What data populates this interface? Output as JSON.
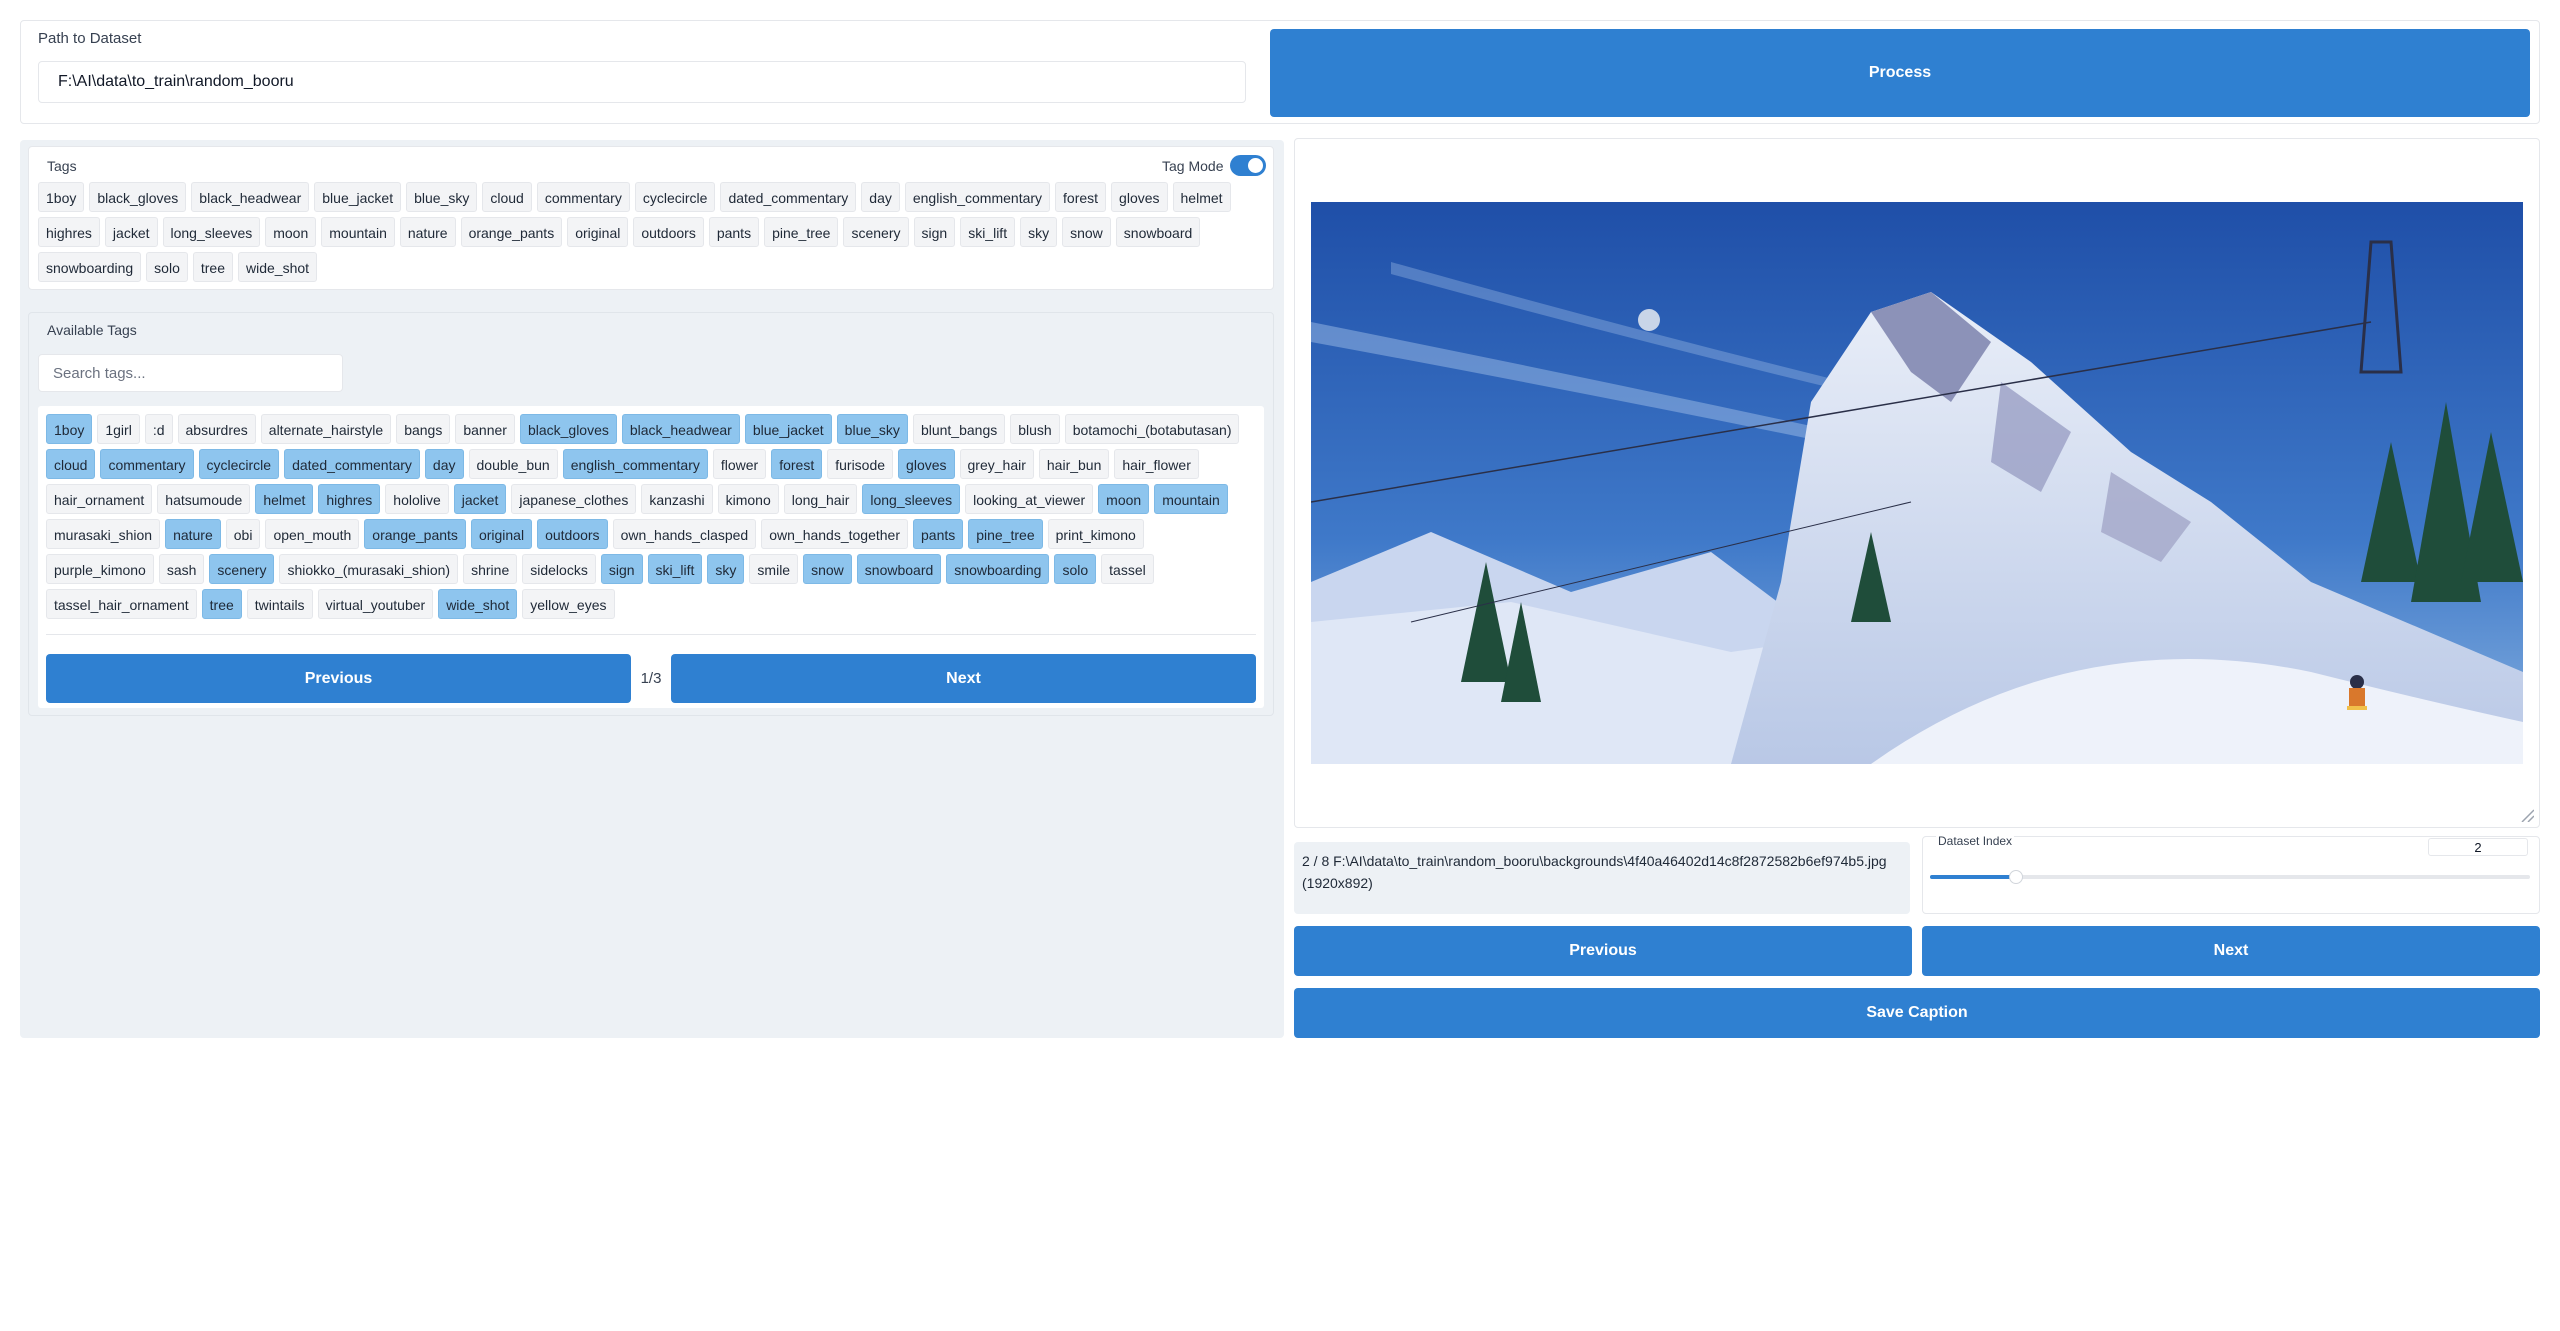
{
  "dataset": {
    "path_label": "Path to Dataset",
    "path_value": "F:\\AI\\data\\to_train\\random_booru",
    "process_label": "Process"
  },
  "tags_panel": {
    "label": "Tags",
    "tag_mode_label": "Tag Mode",
    "tag_mode_on": true,
    "tags": [
      "1boy",
      "black_gloves",
      "black_headwear",
      "blue_jacket",
      "blue_sky",
      "cloud",
      "commentary",
      "cyclecircle",
      "dated_commentary",
      "day",
      "english_commentary",
      "forest",
      "gloves",
      "helmet",
      "highres",
      "jacket",
      "long_sleeves",
      "moon",
      "mountain",
      "nature",
      "orange_pants",
      "original",
      "outdoors",
      "pants",
      "pine_tree",
      "scenery",
      "sign",
      "ski_lift",
      "sky",
      "snow",
      "snowboard",
      "snowboarding",
      "solo",
      "tree",
      "wide_shot"
    ]
  },
  "available_tags": {
    "label": "Available Tags",
    "search_placeholder": "Search tags...",
    "tags": [
      {
        "text": "1boy",
        "active": true
      },
      {
        "text": "1girl",
        "active": false
      },
      {
        "text": ":d",
        "active": false
      },
      {
        "text": "absurdres",
        "active": false
      },
      {
        "text": "alternate_hairstyle",
        "active": false
      },
      {
        "text": "bangs",
        "active": false
      },
      {
        "text": "banner",
        "active": false
      },
      {
        "text": "black_gloves",
        "active": true
      },
      {
        "text": "black_headwear",
        "active": true
      },
      {
        "text": "blue_jacket",
        "active": true
      },
      {
        "text": "blue_sky",
        "active": true
      },
      {
        "text": "blunt_bangs",
        "active": false
      },
      {
        "text": "blush",
        "active": false
      },
      {
        "text": "botamochi_(botabutasan)",
        "active": false
      },
      {
        "text": "cloud",
        "active": true
      },
      {
        "text": "commentary",
        "active": true
      },
      {
        "text": "cyclecircle",
        "active": true
      },
      {
        "text": "dated_commentary",
        "active": true
      },
      {
        "text": "day",
        "active": true
      },
      {
        "text": "double_bun",
        "active": false
      },
      {
        "text": "english_commentary",
        "active": true
      },
      {
        "text": "flower",
        "active": false
      },
      {
        "text": "forest",
        "active": true
      },
      {
        "text": "furisode",
        "active": false
      },
      {
        "text": "gloves",
        "active": true
      },
      {
        "text": "grey_hair",
        "active": false
      },
      {
        "text": "hair_bun",
        "active": false
      },
      {
        "text": "hair_flower",
        "active": false
      },
      {
        "text": "hair_ornament",
        "active": false
      },
      {
        "text": "hatsumoude",
        "active": false
      },
      {
        "text": "helmet",
        "active": true
      },
      {
        "text": "highres",
        "active": true
      },
      {
        "text": "hololive",
        "active": false
      },
      {
        "text": "jacket",
        "active": true
      },
      {
        "text": "japanese_clothes",
        "active": false
      },
      {
        "text": "kanzashi",
        "active": false
      },
      {
        "text": "kimono",
        "active": false
      },
      {
        "text": "long_hair",
        "active": false
      },
      {
        "text": "long_sleeves",
        "active": true
      },
      {
        "text": "looking_at_viewer",
        "active": false
      },
      {
        "text": "moon",
        "active": true
      },
      {
        "text": "mountain",
        "active": true
      },
      {
        "text": "murasaki_shion",
        "active": false
      },
      {
        "text": "nature",
        "active": true
      },
      {
        "text": "obi",
        "active": false
      },
      {
        "text": "open_mouth",
        "active": false
      },
      {
        "text": "orange_pants",
        "active": true
      },
      {
        "text": "original",
        "active": true
      },
      {
        "text": "outdoors",
        "active": true
      },
      {
        "text": "own_hands_clasped",
        "active": false
      },
      {
        "text": "own_hands_together",
        "active": false
      },
      {
        "text": "pants",
        "active": true
      },
      {
        "text": "pine_tree",
        "active": true
      },
      {
        "text": "print_kimono",
        "active": false
      },
      {
        "text": "purple_kimono",
        "active": false
      },
      {
        "text": "sash",
        "active": false
      },
      {
        "text": "scenery",
        "active": true
      },
      {
        "text": "shiokko_(murasaki_shion)",
        "active": false
      },
      {
        "text": "shrine",
        "active": false
      },
      {
        "text": "sidelocks",
        "active": false
      },
      {
        "text": "sign",
        "active": true
      },
      {
        "text": "ski_lift",
        "active": true
      },
      {
        "text": "sky",
        "active": true
      },
      {
        "text": "smile",
        "active": false
      },
      {
        "text": "snow",
        "active": true
      },
      {
        "text": "snowboard",
        "active": true
      },
      {
        "text": "snowboarding",
        "active": true
      },
      {
        "text": "solo",
        "active": true
      },
      {
        "text": "tassel",
        "active": false
      },
      {
        "text": "tassel_hair_ornament",
        "active": false
      },
      {
        "text": "tree",
        "active": true
      },
      {
        "text": "twintails",
        "active": false
      },
      {
        "text": "virtual_youtuber",
        "active": false
      },
      {
        "text": "wide_shot",
        "active": true
      },
      {
        "text": "yellow_eyes",
        "active": false
      }
    ],
    "prev_label": "Previous",
    "next_label": "Next",
    "page": "1/3"
  },
  "image_panel": {
    "info_line1": "2 / 8 F:\\AI\\data\\to_train\\random_booru\\backgrounds\\4f40a46402d14c8f2872582b6ef974b5.jpg",
    "info_line2": "(1920x892)",
    "index_label": "Dataset Index",
    "index_value": "2",
    "index_fraction": 0.143,
    "prev_label": "Previous",
    "next_label": "Next",
    "save_label": "Save Caption"
  },
  "colors": {
    "accent": "#2f80d1",
    "chip_active": "#8ec5ee",
    "chip_inactive": "#f3f4f6",
    "panel_bg": "#edf1f5"
  }
}
